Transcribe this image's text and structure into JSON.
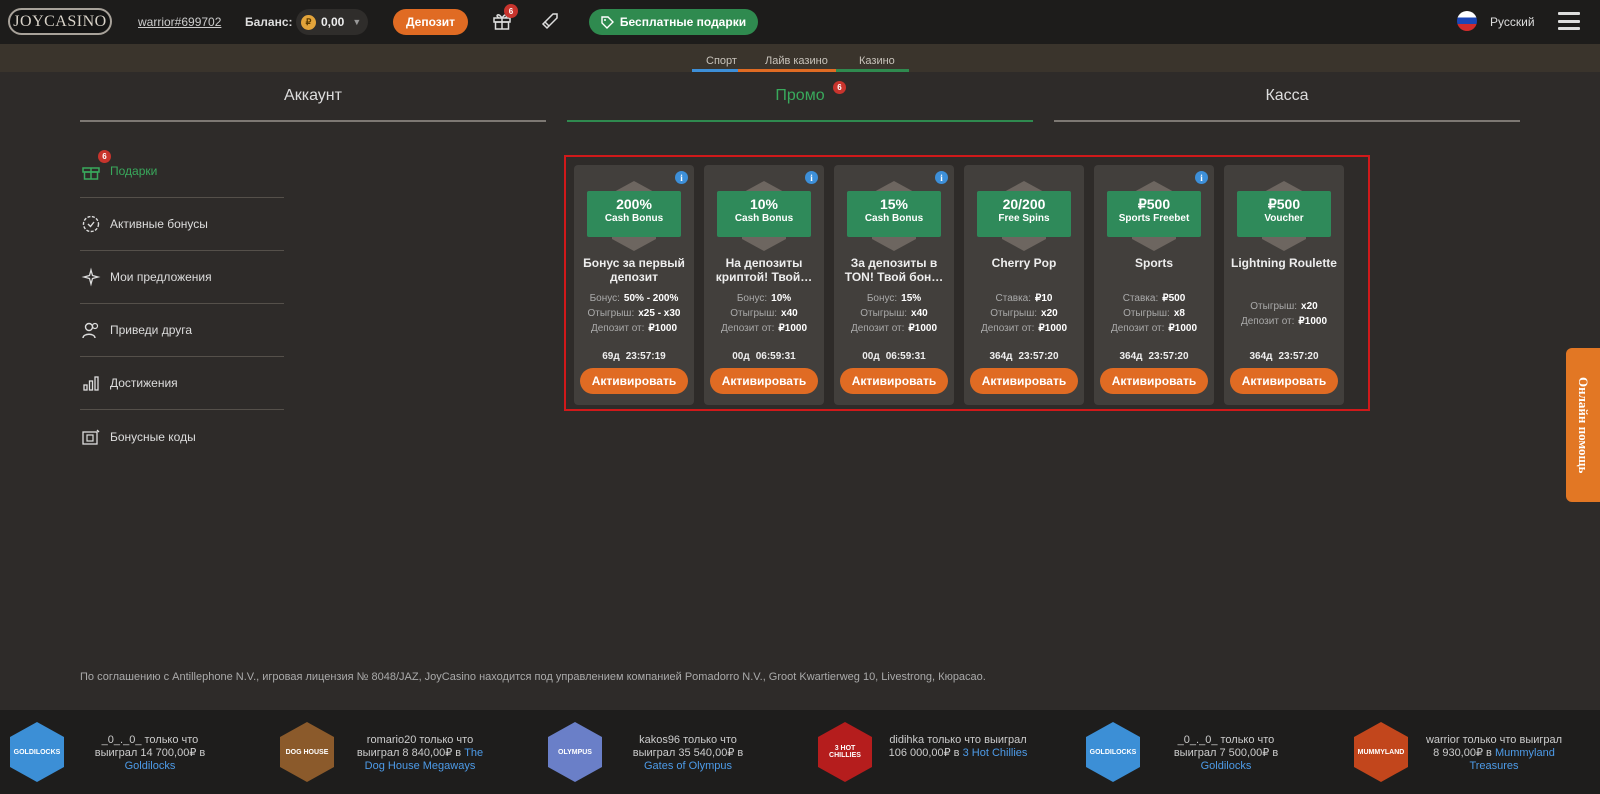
{
  "header": {
    "logo": "JOYCASINO",
    "username": "warrior#699702",
    "balance_label": "Баланс:",
    "balance_value": "0,00",
    "coin_symbol": "₽",
    "deposit_label": "Депозит",
    "gift_count": "6",
    "free_gifts_label": "Бесплатные подарки",
    "language": "Русский"
  },
  "subnav": {
    "sport": "Спорт",
    "live": "Лайв казино",
    "casino": "Казино"
  },
  "tabs": {
    "account": "Аккаунт",
    "promo": "Промо",
    "promo_badge": "6",
    "cashier": "Касса"
  },
  "menu": {
    "gifts": "Подарки",
    "gifts_badge": "6",
    "active_bonuses": "Активные бонусы",
    "my_offers": "Мои предложения",
    "refer": "Приведи друга",
    "achievements": "Достижения",
    "bonus_codes": "Бонусные коды"
  },
  "cards": [
    {
      "big": "200%",
      "small": "Cash Bonus",
      "title": "Бонус за первый депозит",
      "rows": [
        [
          "Бонус:",
          "50% - 200%"
        ],
        [
          "Отыгрыш:",
          "x25 - x30"
        ],
        [
          "Депозит от:",
          "₽1000"
        ]
      ],
      "days": "69д",
      "time": "23:57:19",
      "action": "Активировать",
      "info": "i"
    },
    {
      "big": "10%",
      "small": "Cash Bonus",
      "title": "На депозиты криптой! Твой…",
      "rows": [
        [
          "Бонус:",
          "10%"
        ],
        [
          "Отыгрыш:",
          "x40"
        ],
        [
          "Депозит от:",
          "₽1000"
        ]
      ],
      "days": "00д",
      "time": "06:59:31",
      "action": "Активировать",
      "info": "i"
    },
    {
      "big": "15%",
      "small": "Cash Bonus",
      "title": "За депозиты в TON! Твой бон…",
      "rows": [
        [
          "Бонус:",
          "15%"
        ],
        [
          "Отыгрыш:",
          "x40"
        ],
        [
          "Депозит от:",
          "₽1000"
        ]
      ],
      "days": "00д",
      "time": "06:59:31",
      "action": "Активировать",
      "info": "i"
    },
    {
      "big": "20/200",
      "small": "Free Spins",
      "title": "Cherry Pop",
      "rows": [
        [
          "Ставка:",
          "₽10"
        ],
        [
          "Отыгрыш:",
          "x20"
        ],
        [
          "Депозит от:",
          "₽1000"
        ]
      ],
      "days": "364д",
      "time": "23:57:20",
      "action": "Активировать",
      "info": ""
    },
    {
      "big": "₽500",
      "small": "Sports Freebet",
      "title": "Sports",
      "rows": [
        [
          "Ставка:",
          "₽500"
        ],
        [
          "Отыгрыш:",
          "x8"
        ],
        [
          "Депозит от:",
          "₽1000"
        ]
      ],
      "days": "364д",
      "time": "23:57:20",
      "action": "Активировать",
      "info": "i"
    },
    {
      "big": "₽500",
      "small": "Voucher",
      "title": "Lightning Roulette",
      "rows": [
        [
          "Отыгрыш:",
          "x20"
        ],
        [
          "Депозит от:",
          "₽1000"
        ]
      ],
      "days": "364д",
      "time": "23:57:20",
      "action": "Активировать",
      "info": ""
    }
  ],
  "help_label": "Онлайн помощь",
  "legal": "По соглашению с Antillephone N.V., игровая лицензия № 8048/JAZ, JoyCasino находится под управлением компанией Pomadorro N.V., Groot Kwartierweg 10, Livestrong, Кюрасао.",
  "wins": [
    {
      "thumb": "GOLDILOCKS",
      "text": "_0_._0_ только что выиграл 14 700,00₽ в ",
      "game": "Goldilocks",
      "color": "#3c8fd6"
    },
    {
      "thumb": "DOG HOUSE",
      "text": "romario20 только что выиграл 8 840,00₽ в ",
      "game": "The Dog House Megaways",
      "color": "#8b5a2b"
    },
    {
      "thumb": "OLYMPUS",
      "text": "kakos96 только что выиграл 35 540,00₽ в ",
      "game": "Gates of Olympus",
      "color": "#6a7fc8"
    },
    {
      "thumb": "3 HOT CHILLIES",
      "text": "didihka только что выиграл 106 000,00₽ в ",
      "game": "3 Hot Chillies",
      "color": "#b51d1d"
    },
    {
      "thumb": "GOLDILOCKS",
      "text": "_0_._0_ только что выиграл 7 500,00₽ в ",
      "game": "Goldilocks",
      "color": "#3c8fd6"
    },
    {
      "thumb": "MUMMYLAND",
      "text": "warrior только что выиграл 8 930,00₽ в ",
      "game": "Mummyland Treasures",
      "color": "#c2461c"
    }
  ]
}
